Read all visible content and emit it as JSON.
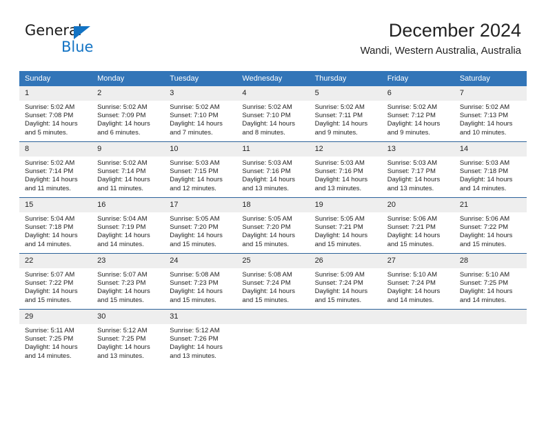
{
  "logo": {
    "word_one": "General",
    "word_two": "Blue",
    "triangle_icon": "blue-triangle-icon",
    "accent_color": "#1273c4"
  },
  "header": {
    "title": "December 2024",
    "subtitle": "Wandi, Western Australia, Australia"
  },
  "theme": {
    "header_blue": "#3275b8",
    "daynum_gray": "#eeeeee",
    "row_rule_blue": "#2a6099"
  },
  "calendar": {
    "weekday_headers": [
      "Sunday",
      "Monday",
      "Tuesday",
      "Wednesday",
      "Thursday",
      "Friday",
      "Saturday"
    ],
    "weeks": [
      [
        {
          "day": "1",
          "sunrise": "Sunrise: 5:02 AM",
          "sunset": "Sunset: 7:08 PM",
          "daylight_line1": "Daylight: 14 hours",
          "daylight_line2": "and 5 minutes."
        },
        {
          "day": "2",
          "sunrise": "Sunrise: 5:02 AM",
          "sunset": "Sunset: 7:09 PM",
          "daylight_line1": "Daylight: 14 hours",
          "daylight_line2": "and 6 minutes."
        },
        {
          "day": "3",
          "sunrise": "Sunrise: 5:02 AM",
          "sunset": "Sunset: 7:10 PM",
          "daylight_line1": "Daylight: 14 hours",
          "daylight_line2": "and 7 minutes."
        },
        {
          "day": "4",
          "sunrise": "Sunrise: 5:02 AM",
          "sunset": "Sunset: 7:10 PM",
          "daylight_line1": "Daylight: 14 hours",
          "daylight_line2": "and 8 minutes."
        },
        {
          "day": "5",
          "sunrise": "Sunrise: 5:02 AM",
          "sunset": "Sunset: 7:11 PM",
          "daylight_line1": "Daylight: 14 hours",
          "daylight_line2": "and 9 minutes."
        },
        {
          "day": "6",
          "sunrise": "Sunrise: 5:02 AM",
          "sunset": "Sunset: 7:12 PM",
          "daylight_line1": "Daylight: 14 hours",
          "daylight_line2": "and 9 minutes."
        },
        {
          "day": "7",
          "sunrise": "Sunrise: 5:02 AM",
          "sunset": "Sunset: 7:13 PM",
          "daylight_line1": "Daylight: 14 hours",
          "daylight_line2": "and 10 minutes."
        }
      ],
      [
        {
          "day": "8",
          "sunrise": "Sunrise: 5:02 AM",
          "sunset": "Sunset: 7:14 PM",
          "daylight_line1": "Daylight: 14 hours",
          "daylight_line2": "and 11 minutes."
        },
        {
          "day": "9",
          "sunrise": "Sunrise: 5:02 AM",
          "sunset": "Sunset: 7:14 PM",
          "daylight_line1": "Daylight: 14 hours",
          "daylight_line2": "and 11 minutes."
        },
        {
          "day": "10",
          "sunrise": "Sunrise: 5:03 AM",
          "sunset": "Sunset: 7:15 PM",
          "daylight_line1": "Daylight: 14 hours",
          "daylight_line2": "and 12 minutes."
        },
        {
          "day": "11",
          "sunrise": "Sunrise: 5:03 AM",
          "sunset": "Sunset: 7:16 PM",
          "daylight_line1": "Daylight: 14 hours",
          "daylight_line2": "and 13 minutes."
        },
        {
          "day": "12",
          "sunrise": "Sunrise: 5:03 AM",
          "sunset": "Sunset: 7:16 PM",
          "daylight_line1": "Daylight: 14 hours",
          "daylight_line2": "and 13 minutes."
        },
        {
          "day": "13",
          "sunrise": "Sunrise: 5:03 AM",
          "sunset": "Sunset: 7:17 PM",
          "daylight_line1": "Daylight: 14 hours",
          "daylight_line2": "and 13 minutes."
        },
        {
          "day": "14",
          "sunrise": "Sunrise: 5:03 AM",
          "sunset": "Sunset: 7:18 PM",
          "daylight_line1": "Daylight: 14 hours",
          "daylight_line2": "and 14 minutes."
        }
      ],
      [
        {
          "day": "15",
          "sunrise": "Sunrise: 5:04 AM",
          "sunset": "Sunset: 7:18 PM",
          "daylight_line1": "Daylight: 14 hours",
          "daylight_line2": "and 14 minutes."
        },
        {
          "day": "16",
          "sunrise": "Sunrise: 5:04 AM",
          "sunset": "Sunset: 7:19 PM",
          "daylight_line1": "Daylight: 14 hours",
          "daylight_line2": "and 14 minutes."
        },
        {
          "day": "17",
          "sunrise": "Sunrise: 5:05 AM",
          "sunset": "Sunset: 7:20 PM",
          "daylight_line1": "Daylight: 14 hours",
          "daylight_line2": "and 15 minutes."
        },
        {
          "day": "18",
          "sunrise": "Sunrise: 5:05 AM",
          "sunset": "Sunset: 7:20 PM",
          "daylight_line1": "Daylight: 14 hours",
          "daylight_line2": "and 15 minutes."
        },
        {
          "day": "19",
          "sunrise": "Sunrise: 5:05 AM",
          "sunset": "Sunset: 7:21 PM",
          "daylight_line1": "Daylight: 14 hours",
          "daylight_line2": "and 15 minutes."
        },
        {
          "day": "20",
          "sunrise": "Sunrise: 5:06 AM",
          "sunset": "Sunset: 7:21 PM",
          "daylight_line1": "Daylight: 14 hours",
          "daylight_line2": "and 15 minutes."
        },
        {
          "day": "21",
          "sunrise": "Sunrise: 5:06 AM",
          "sunset": "Sunset: 7:22 PM",
          "daylight_line1": "Daylight: 14 hours",
          "daylight_line2": "and 15 minutes."
        }
      ],
      [
        {
          "day": "22",
          "sunrise": "Sunrise: 5:07 AM",
          "sunset": "Sunset: 7:22 PM",
          "daylight_line1": "Daylight: 14 hours",
          "daylight_line2": "and 15 minutes."
        },
        {
          "day": "23",
          "sunrise": "Sunrise: 5:07 AM",
          "sunset": "Sunset: 7:23 PM",
          "daylight_line1": "Daylight: 14 hours",
          "daylight_line2": "and 15 minutes."
        },
        {
          "day": "24",
          "sunrise": "Sunrise: 5:08 AM",
          "sunset": "Sunset: 7:23 PM",
          "daylight_line1": "Daylight: 14 hours",
          "daylight_line2": "and 15 minutes."
        },
        {
          "day": "25",
          "sunrise": "Sunrise: 5:08 AM",
          "sunset": "Sunset: 7:24 PM",
          "daylight_line1": "Daylight: 14 hours",
          "daylight_line2": "and 15 minutes."
        },
        {
          "day": "26",
          "sunrise": "Sunrise: 5:09 AM",
          "sunset": "Sunset: 7:24 PM",
          "daylight_line1": "Daylight: 14 hours",
          "daylight_line2": "and 15 minutes."
        },
        {
          "day": "27",
          "sunrise": "Sunrise: 5:10 AM",
          "sunset": "Sunset: 7:24 PM",
          "daylight_line1": "Daylight: 14 hours",
          "daylight_line2": "and 14 minutes."
        },
        {
          "day": "28",
          "sunrise": "Sunrise: 5:10 AM",
          "sunset": "Sunset: 7:25 PM",
          "daylight_line1": "Daylight: 14 hours",
          "daylight_line2": "and 14 minutes."
        }
      ],
      [
        {
          "day": "29",
          "sunrise": "Sunrise: 5:11 AM",
          "sunset": "Sunset: 7:25 PM",
          "daylight_line1": "Daylight: 14 hours",
          "daylight_line2": "and 14 minutes."
        },
        {
          "day": "30",
          "sunrise": "Sunrise: 5:12 AM",
          "sunset": "Sunset: 7:25 PM",
          "daylight_line1": "Daylight: 14 hours",
          "daylight_line2": "and 13 minutes."
        },
        {
          "day": "31",
          "sunrise": "Sunrise: 5:12 AM",
          "sunset": "Sunset: 7:26 PM",
          "daylight_line1": "Daylight: 14 hours",
          "daylight_line2": "and 13 minutes."
        },
        {
          "day": "",
          "sunrise": "",
          "sunset": "",
          "daylight_line1": "",
          "daylight_line2": ""
        },
        {
          "day": "",
          "sunrise": "",
          "sunset": "",
          "daylight_line1": "",
          "daylight_line2": ""
        },
        {
          "day": "",
          "sunrise": "",
          "sunset": "",
          "daylight_line1": "",
          "daylight_line2": ""
        },
        {
          "day": "",
          "sunrise": "",
          "sunset": "",
          "daylight_line1": "",
          "daylight_line2": ""
        }
      ]
    ]
  }
}
